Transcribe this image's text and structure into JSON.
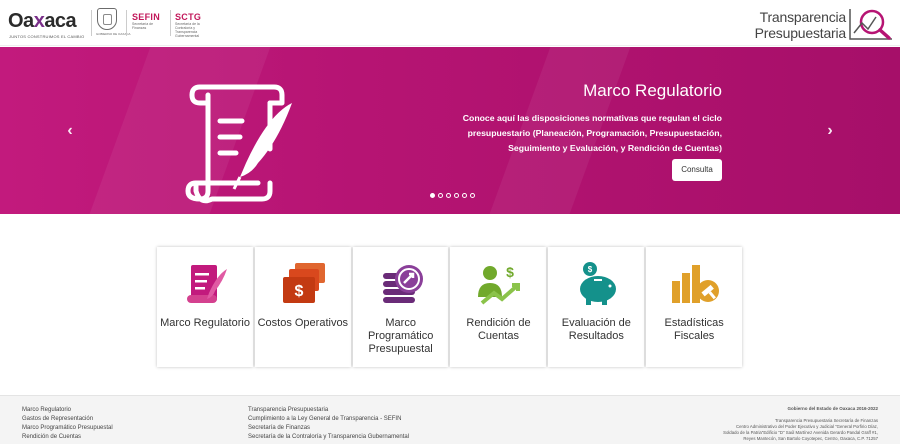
{
  "header": {
    "oaxaca_word_pre": "Oa",
    "oaxaca_word_x": "x",
    "oaxaca_word_post": "aca",
    "oaxaca_tag": "JUNTOS CONSTRUIMOS EL CAMBIO",
    "coat_caption": "GOBIERNO DE OAXACA",
    "sefin_title": "SEFIN",
    "sefin_sub": "Secretaría de Finanzas",
    "sctg_title": "SCTG",
    "sctg_sub": "Secretaría de la Contraloría y Transparencia Gubernamental",
    "tp_line1": "Transparencia",
    "tp_line2": "Presupuestaria"
  },
  "carousel": {
    "title": "Marco Regulatorio",
    "description": "Conoce aquí las disposiciones normativas que regulan el ciclo presupuestario (Planeación, Programación, Presupuestación, Seguimiento y Evaluación, y Rendición de Cuentas)",
    "button_label": "Consulta",
    "prev_arrow": "‹",
    "next_arrow": "›",
    "slide_count": 6,
    "active_slide": 1
  },
  "tiles": [
    {
      "label": "Marco Regulatorio",
      "icon": "scroll-quill-icon",
      "color": "#c21a7d"
    },
    {
      "label": "Costos Operativos",
      "icon": "bills-icon",
      "color": "#d9481d"
    },
    {
      "label": "Marco Programático Presupuestal",
      "icon": "coins-icon",
      "color": "#6a2b78"
    },
    {
      "label": "Rendición de Cuentas",
      "icon": "growth-person-icon",
      "color": "#71a92c"
    },
    {
      "label": "Evaluación de Resultados",
      "icon": "piggy-bank-icon",
      "color": "#14918b"
    },
    {
      "label": "Estadísticas Fiscales",
      "icon": "bar-chart-gavel-icon",
      "color": "#e0a02a"
    }
  ],
  "footer": {
    "col1": [
      "Marco Regulatorio",
      "Gastos de Representación",
      "Marco Programático Presupuestal",
      "Rendición de Cuentas"
    ],
    "col2": [
      "Transparencia Presupuestaria",
      "Cumplimiento a la Ley General de Transparencia - SEFIN",
      "Secretaría de Finanzas",
      "Secretaría de la Contraloría y Transparencia Gubernamental"
    ],
    "col3_heading": "Gobierno del Estado de Oaxaca 2016-2022",
    "col3_lines": [
      "Transparencia Presupuestaria Secretaría de Finanzas",
      "Centro Administrativo del Poder Ejecutivo y Judicial \"General Porfirio Díaz,",
      "Soldado de la Patria\"Edificio \"D\" Saúl Martínez Avenida Gerardo Pandal Graff #1,",
      "Reyes Mantecón, San Bartolo Coyotepec, Centro, Oaxaca, C.P. 71257"
    ]
  },
  "colors": {
    "brand_magenta": "#b61473",
    "brand_red": "#c2185b"
  }
}
